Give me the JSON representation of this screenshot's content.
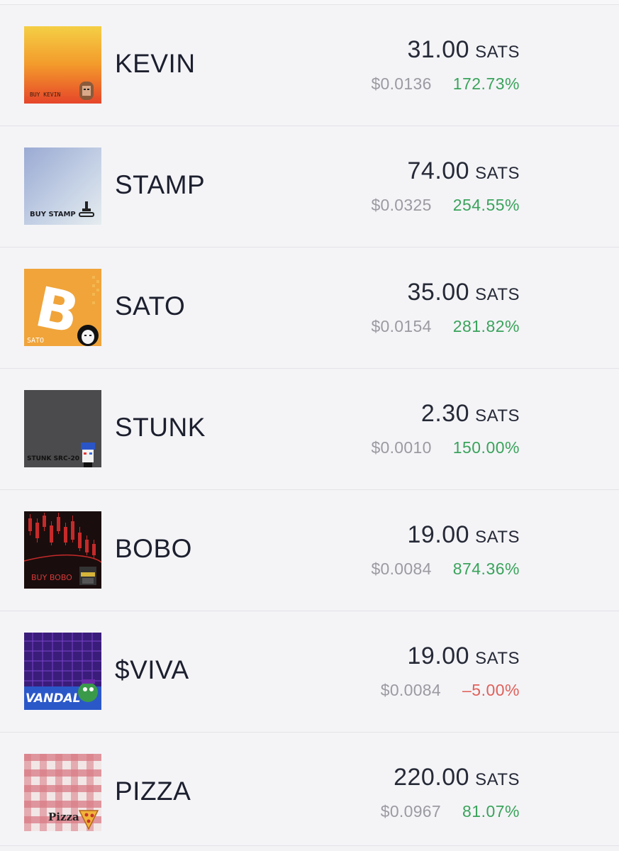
{
  "rows": [
    {
      "ticker": "KEVIN",
      "price": "31.00",
      "unit": "SATS",
      "usd": "$0.0136",
      "change": "172.73%",
      "change_color": "#3aa35b",
      "logo_text": "BUY KEVIN"
    },
    {
      "ticker": "STAMP",
      "price": "74.00",
      "unit": "SATS",
      "usd": "$0.0325",
      "change": "254.55%",
      "change_color": "#3aa35b",
      "logo_text": "BUY STAMP"
    },
    {
      "ticker": "SATO",
      "price": "35.00",
      "unit": "SATS",
      "usd": "$0.0154",
      "change": "281.82%",
      "change_color": "#3aa35b",
      "logo_text": "SATO"
    },
    {
      "ticker": "STUNK",
      "price": "2.30",
      "unit": "SATS",
      "usd": "$0.0010",
      "change": "150.00%",
      "change_color": "#3aa35b",
      "logo_text": "STUNK SRC-20"
    },
    {
      "ticker": "BOBO",
      "price": "19.00",
      "unit": "SATS",
      "usd": "$0.0084",
      "change": "874.36%",
      "change_color": "#3aa35b",
      "logo_text": "BUY BOBO"
    },
    {
      "ticker": "$VIVA",
      "price": "19.00",
      "unit": "SATS",
      "usd": "$0.0084",
      "change": "–5.00%",
      "change_color": "#e0605a",
      "logo_text": "VANDAL"
    },
    {
      "ticker": "PIZZA",
      "price": "220.00",
      "unit": "SATS",
      "usd": "$0.0967",
      "change": "81.07%",
      "change_color": "#3aa35b",
      "logo_text": "Pizza"
    }
  ]
}
